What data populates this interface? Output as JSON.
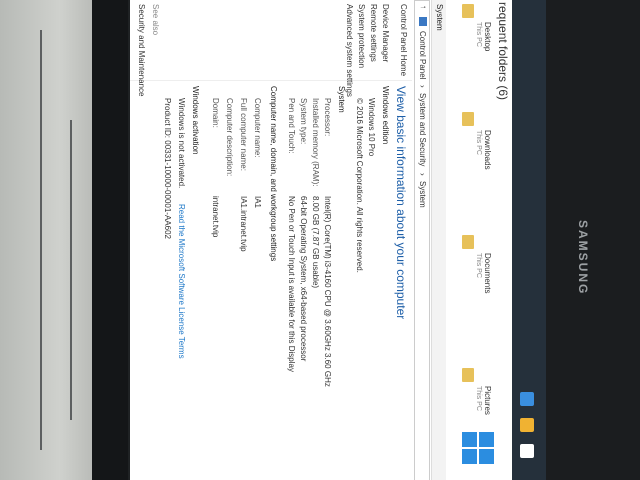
{
  "monitor_brand": "SAMSUNG",
  "frequent_folders": {
    "title": "requent folders (6)",
    "items": [
      {
        "name": "Desktop",
        "sub": "This PC"
      },
      {
        "name": "Downloads",
        "sub": "This PC"
      },
      {
        "name": "Documents",
        "sub": "This PC"
      },
      {
        "name": "Pictures",
        "sub": "This PC"
      }
    ]
  },
  "window": {
    "title": "System"
  },
  "address": {
    "back_arrow": "↑",
    "crumbs": [
      "Control Panel",
      "System and Security",
      "System"
    ]
  },
  "sidebar": {
    "home": "Control Panel Home",
    "items": [
      "Device Manager",
      "Remote settings",
      "System protection",
      "Advanced system settings"
    ],
    "see_also": "See also",
    "see_also_items": [
      "Security and Maintenance"
    ]
  },
  "main": {
    "heading": "View basic information about your computer",
    "edition_section": "Windows edition",
    "edition": "Windows 10 Pro",
    "copyright": "© 2016 Microsoft Corporation. All rights reserved.",
    "system_section": "System",
    "system_rows": [
      {
        "label": "Processor:",
        "value": "Intel(R) Core(TM) i3-4160 CPU @ 3.60GHz   3.60 GHz"
      },
      {
        "label": "Installed memory (RAM):",
        "value": "8.00 GB (7.87 GB usable)"
      },
      {
        "label": "System type:",
        "value": "64-bit Operating System, x64-based processor"
      },
      {
        "label": "Pen and Touch:",
        "value": "No Pen or Touch Input is available for this Display"
      }
    ],
    "computer_section": "Computer name, domain, and workgroup settings",
    "computer_rows": [
      {
        "label": "Computer name:",
        "value": "IA1"
      },
      {
        "label": "Full computer name:",
        "value": "IA1.intranet.tvip"
      },
      {
        "label": "Computer description:",
        "value": ""
      },
      {
        "label": "Domain:",
        "value": "intranet.tvip"
      }
    ],
    "activation_section": "Windows activation",
    "activation_status": "Windows is not activated.",
    "activation_link": "Read the Microsoft Software License Terms",
    "product_id": "Product ID: 00331-10000-00001-AA602"
  },
  "colors": {
    "accent": "#1e5fa8",
    "win_logo": "#2b8de0",
    "folder": "#e7c15a"
  }
}
